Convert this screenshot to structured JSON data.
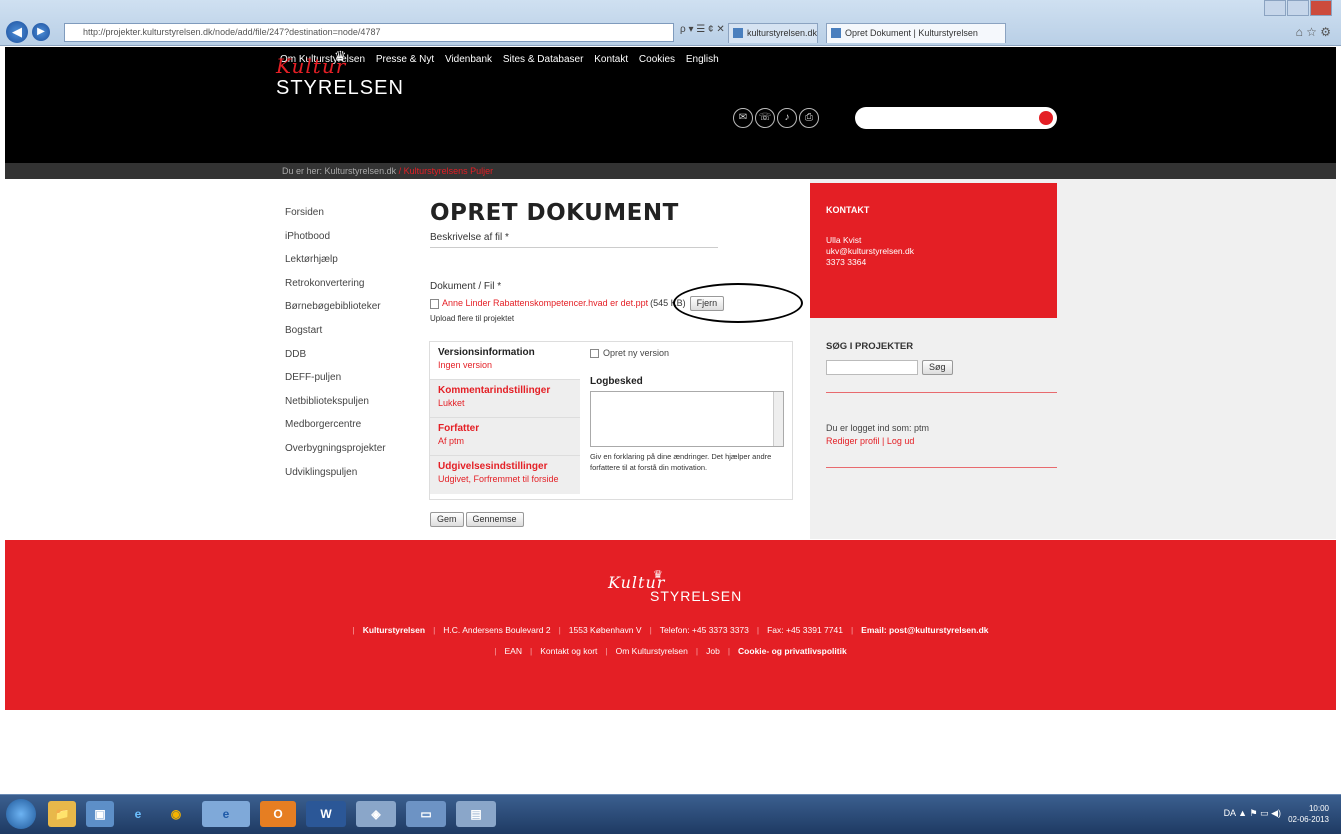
{
  "browser": {
    "address": "http://projekter.kulturstyrelsen.dk/node/add/file/247?destination=node/4787",
    "address_controls": "ρ ▾ ☰ ¢ ✕",
    "tab_inactive": "kulturstyrelsen.dk",
    "tab_active": "Opret Dokument | Kulturstyrelsen",
    "back_icon": "back-arrow-icon",
    "forward_icon": "forward-arrow-icon"
  },
  "site": {
    "topnav": [
      "Om Kulturstyrelsen",
      "Presse & Nyt",
      "Videnbank",
      "Sites & Databaser",
      "Kontakt",
      "Cookies",
      "English"
    ],
    "logo_script": "Kultur",
    "logo_text": "STYRELSEN",
    "tools": [
      "✉",
      "☏",
      "♪",
      "⎙"
    ],
    "breadcrumb_prefix": "Du er her:",
    "breadcrumb_home": "Kulturstyrelsen.dk",
    "breadcrumb_sep": "/",
    "breadcrumb_current": "Kulturstyrelsens Puljer"
  },
  "leftnav": [
    "Forsiden",
    "iPhotbood",
    "Lektørhjælp",
    "Retrokonvertering",
    "Børnebøgebiblioteker",
    "Bogstart",
    "DDB",
    "DEFF-puljen",
    "Netbibliotekspuljen",
    "Medborgercentre",
    "Overbygningsprojekter",
    "Udviklingspuljen"
  ],
  "form": {
    "title": "OPRET DOKUMENT",
    "desc_label": "Beskrivelse af fil *",
    "doc_label": "Dokument / Fil *",
    "doc_link": "Anne Linder Rabattenskompetencer.hvad er det.ppt",
    "doc_size": "(545 KB)",
    "remove_btn": "Fjern",
    "upload_more": "Upload flere til projektet",
    "version_title": "Versionsinformation",
    "version_value": "Ingen version",
    "comment_title": "Kommentarindstillinger",
    "comment_value": "Lukket",
    "author_title": "Forfatter",
    "author_value": "Af ptm",
    "publish_title": "Udgivelsesindstillinger",
    "publish_value": "Udgivet, Forfremmet til forside",
    "new_version": "Opret ny version",
    "log_title": "Logbesked",
    "log_help": "Giv en forklaring på dine ændringer. Det hjælper andre forfattere til at forstå din motivation.",
    "save_btn": "Gem",
    "preview_btn": "Gennemse"
  },
  "sidebar": {
    "contact_title": "KONTAKT",
    "contact_name": "Ulla Kvist",
    "contact_email": "ukv@kulturstyrelsen.dk",
    "contact_phone": "3373 3364",
    "search_title": "SØG I PROJEKTER",
    "search_btn": "Søg",
    "logged_in": "Du er logget ind som: ptm",
    "profile_links": "Rediger profil | Log ud"
  },
  "footer": {
    "logo_script": "Kultur",
    "logo_text": "STYRELSEN",
    "line1": [
      "Kulturstyrelsen",
      "H.C. Andersens Boulevard 2",
      "1553 København V",
      "Telefon: +45 3373 3373",
      "Fax: +45 3391 7741",
      "Email: post@kulturstyrelsen.dk"
    ],
    "line2": [
      "EAN",
      "Kontakt og kort",
      "Om Kulturstyrelsen",
      "Job",
      "Cookie- og privatlivspolitik"
    ]
  },
  "taskbar": {
    "apps": [
      "📁",
      "▣",
      "e",
      "◉",
      "e",
      "O",
      "W",
      "◈",
      "▭",
      "▤"
    ],
    "tray_lang": "DA",
    "tray_icons": "▲ ⚑ ▭ ◀)",
    "time": "10:00",
    "date": "02-06-2013"
  }
}
